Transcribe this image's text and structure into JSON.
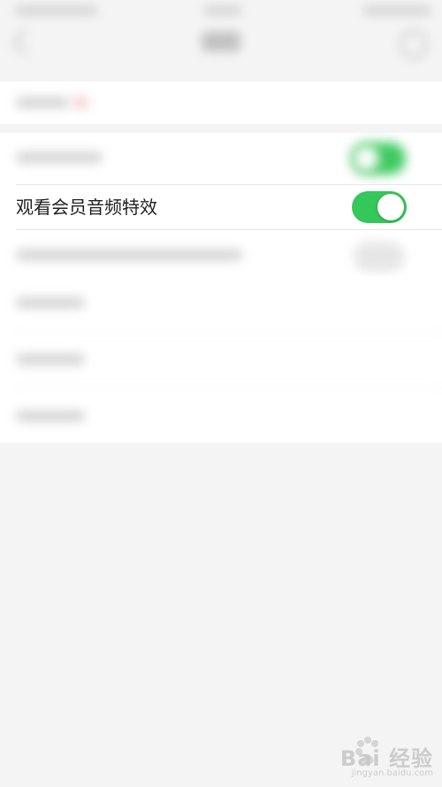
{
  "settings": {
    "rows": [
      {
        "label": "观看会员音频特效",
        "toggle_on": true
      }
    ]
  },
  "colors": {
    "background": "#f4f4f5",
    "card": "#ffffff",
    "toggle_on": "#34c759",
    "text": "#1f1f1f"
  },
  "watermark": {
    "text": "Bai 经验",
    "url": "jingyan.baidu.com"
  },
  "icons": {
    "watermark_logo": "paw-icon"
  }
}
